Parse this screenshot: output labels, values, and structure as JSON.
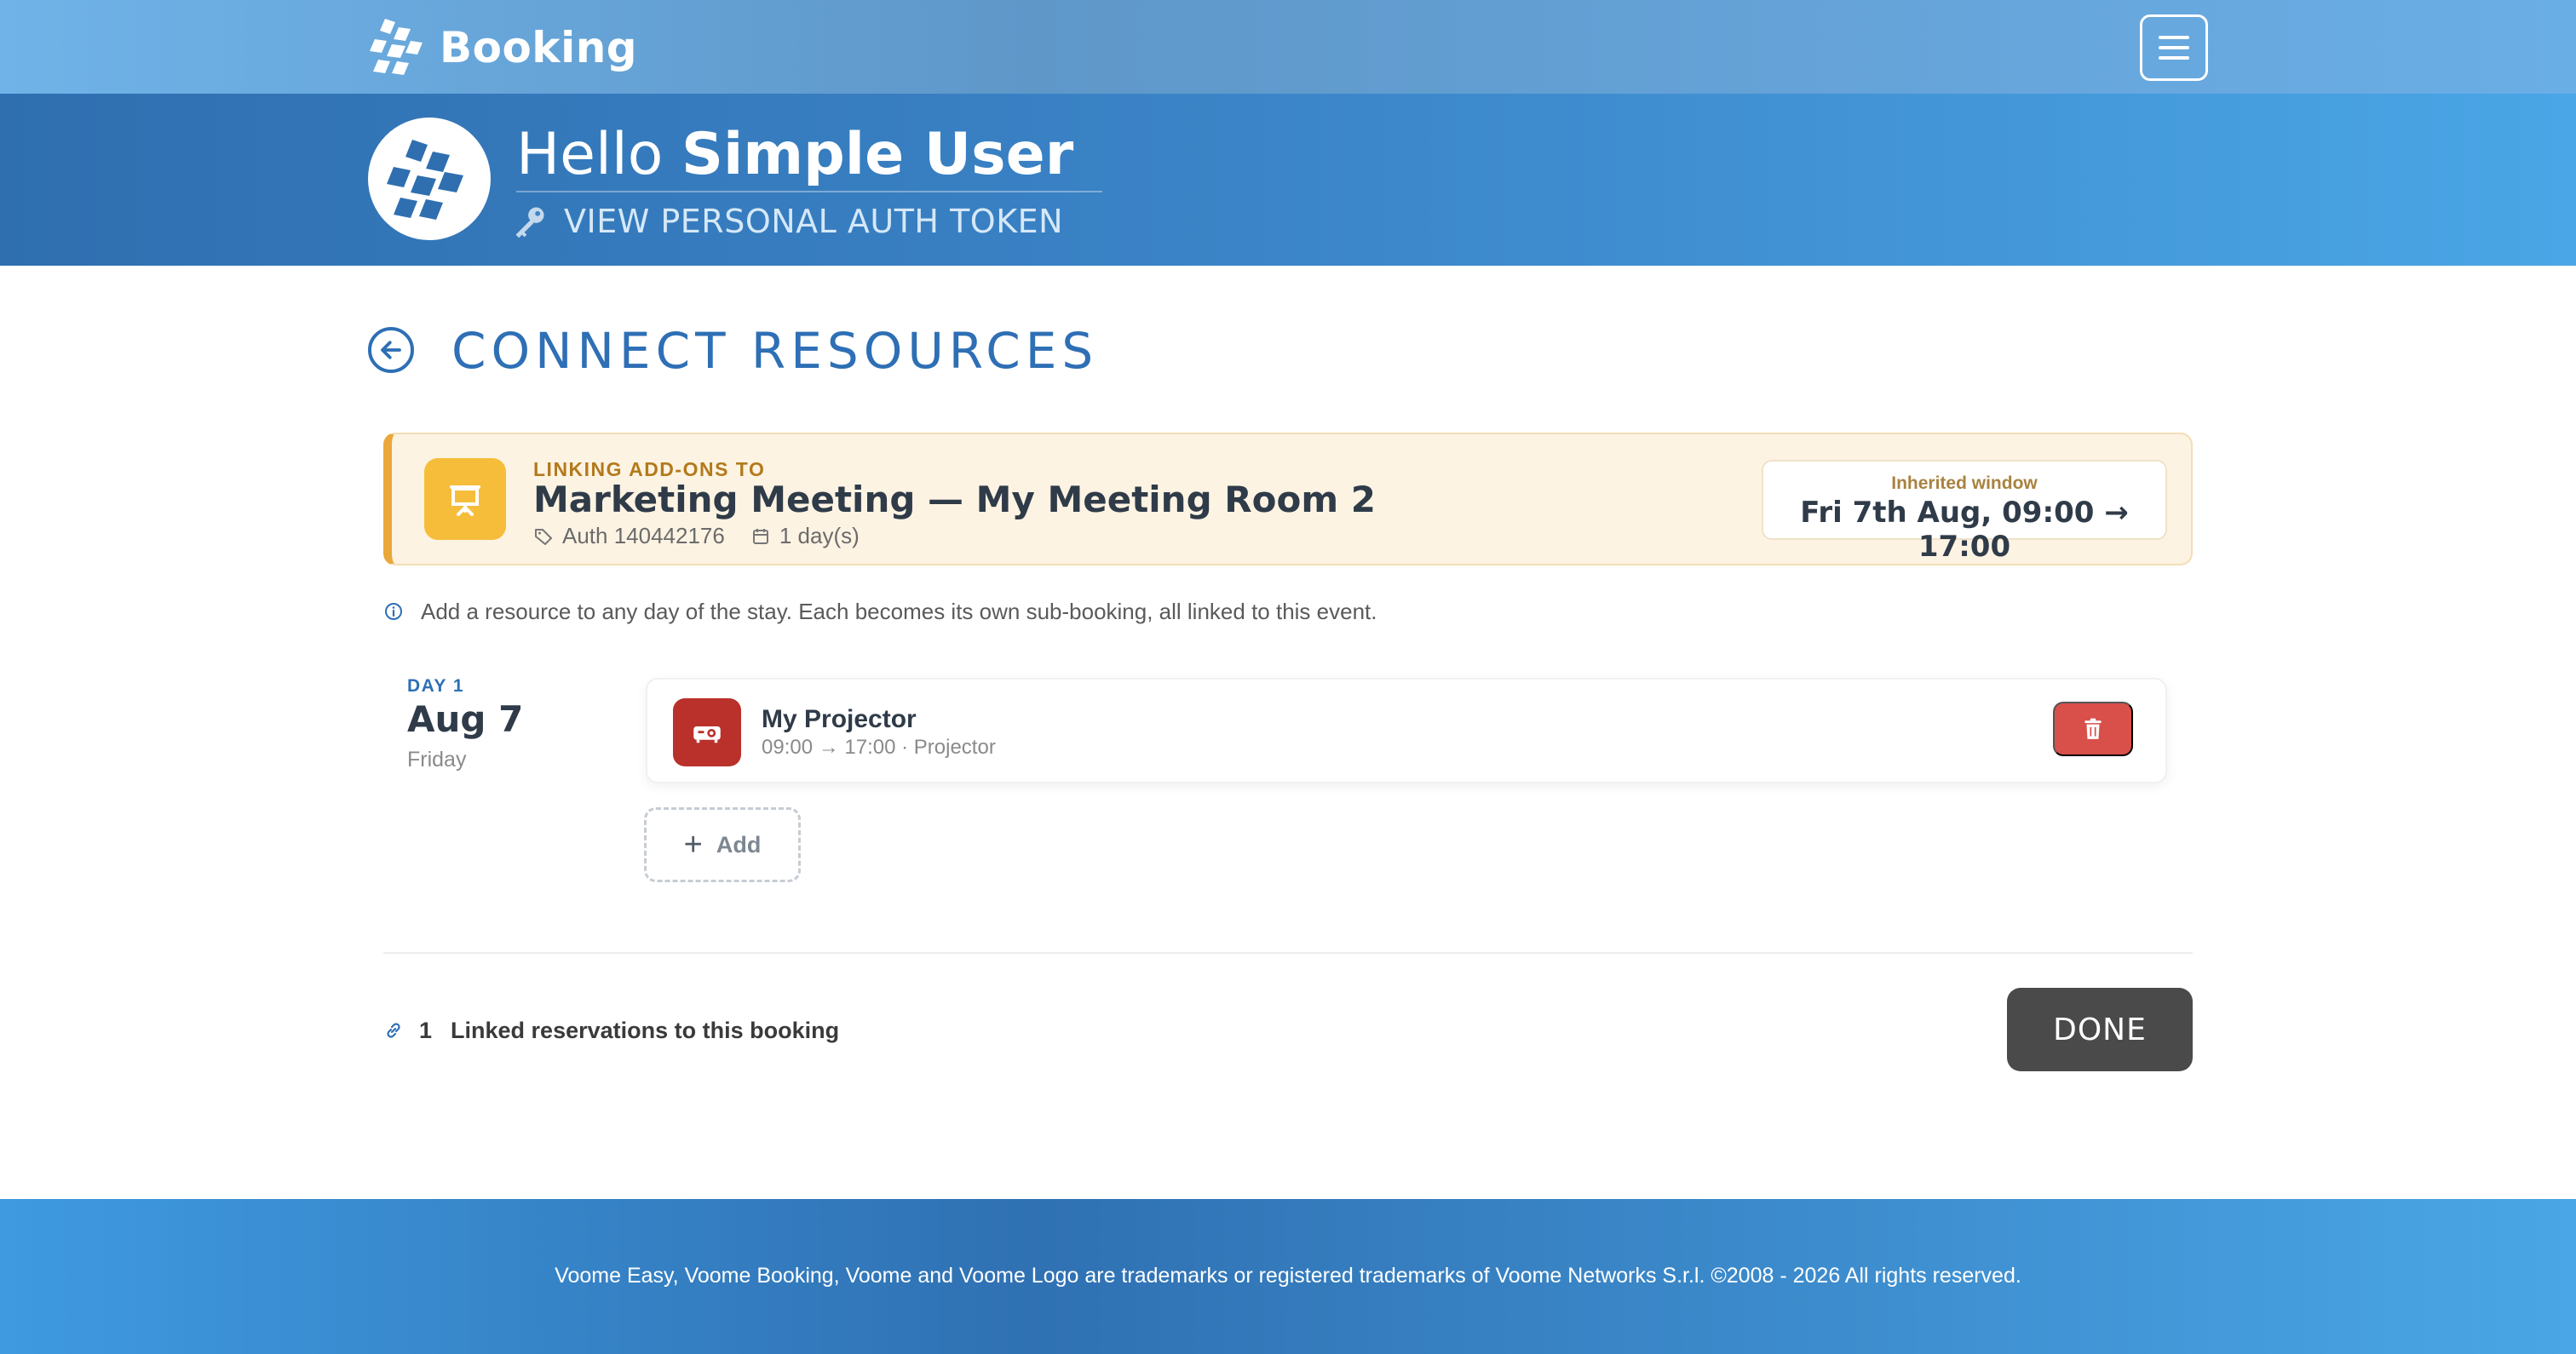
{
  "navbar": {
    "brand": "Booking",
    "menu_icon": "hamburger-icon"
  },
  "hero": {
    "greeting": "Hello",
    "user_name": "Simple User",
    "token_link": "VIEW PERSONAL AUTH TOKEN"
  },
  "page": {
    "title": "CONNECT RESOURCES"
  },
  "link_card": {
    "kicker": "LINKING ADD-ONS TO",
    "title": "Marketing Meeting — My Meeting Room 2",
    "auth": "Auth 140442176",
    "days": "1 day(s)",
    "window_label": "Inherited window",
    "window_value": "Fri 7th Aug, 09:00 → 17:00"
  },
  "info": {
    "text": "Add a resource to any day of the stay. Each becomes its own sub-booking, all linked to this event."
  },
  "days": [
    {
      "label": "DAY 1",
      "date": "Aug 7",
      "weekday": "Friday",
      "resources": [
        {
          "name": "My Projector",
          "details": "09:00 → 17:00 · Projector"
        }
      ],
      "add_label": "Add"
    }
  ],
  "linked": {
    "count": "1",
    "label": "Linked reservations to this booking"
  },
  "actions": {
    "done": "DONE"
  },
  "footer": {
    "text": "Voome Easy, Voome Booking, Voome and Voome Logo are trademarks or registered trademarks of Voome Networks S.r.l. ©2008 - 2026 All rights reserved."
  },
  "colors": {
    "primary": "#2e6fb5",
    "accent": "#f6bd3b",
    "danger": "#d9504a",
    "resource": "#b9312a",
    "done": "#4a4a4a"
  }
}
